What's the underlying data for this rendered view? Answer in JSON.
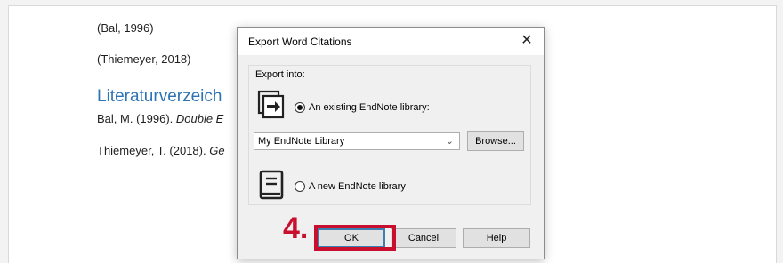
{
  "document": {
    "lines": [
      "(Bal, 1996)",
      "(Thiemeyer, 2018)"
    ],
    "heading": "Literaturverzeich",
    "references": [
      {
        "plain": "Bal, M. (1996). ",
        "italic": "Double E"
      },
      {
        "plain": "Thiemeyer, T. (2018). ",
        "italic": "Ge"
      }
    ]
  },
  "dialog": {
    "title": "Export Word Citations",
    "close_label": "✕",
    "group_label": "Export into:",
    "option_existing": "An existing EndNote library:",
    "option_new": "A new EndNote library",
    "library_select": "My EndNote Library",
    "browse_label": "Browse...",
    "ok_label": "OK",
    "cancel_label": "Cancel",
    "help_label": "Help",
    "selected_option": "existing"
  },
  "annotation": {
    "step_label": "4.",
    "highlight_color": "#c8102e"
  },
  "icons": {
    "library": "library-export-icon",
    "book": "book-icon",
    "chevron": "chevron-down-icon",
    "close": "close-icon"
  }
}
